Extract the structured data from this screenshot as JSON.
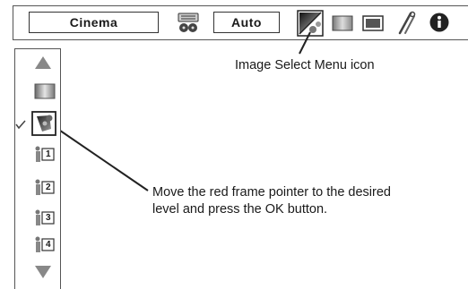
{
  "menubar": {
    "field1": "Cinema",
    "field2": "Auto",
    "icons": [
      "audio-video-icon",
      "image-select-icon",
      "image-adjust-icon",
      "screen-icon",
      "setting-icon",
      "information-icon"
    ]
  },
  "sidebar": {
    "items": [
      {
        "name": "scroll-up-arrow-icon"
      },
      {
        "name": "gradient-level-icon"
      },
      {
        "name": "image-select-icon",
        "selected": true
      },
      {
        "name": "image-1-icon",
        "label": "1"
      },
      {
        "name": "image-2-icon",
        "label": "2"
      },
      {
        "name": "image-3-icon",
        "label": "3"
      },
      {
        "name": "image-4-icon",
        "label": "4"
      },
      {
        "name": "scroll-down-arrow-icon"
      }
    ]
  },
  "annotations": {
    "menu_icon_label": "Image Select Menu icon",
    "pointer_label_line1": "Move the red frame pointer to the desired",
    "pointer_label_line2": "level and press the OK button."
  },
  "colors": {
    "frame": "#555555",
    "dark": "#222222",
    "gray": "#888888"
  }
}
